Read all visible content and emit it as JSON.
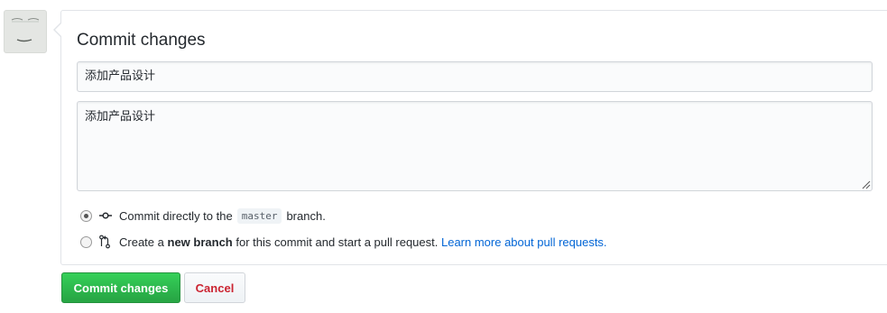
{
  "avatar": {
    "icon": "user-avatar"
  },
  "commit_form": {
    "title": "Commit changes",
    "summary_value": "添加产品设计",
    "description_value": "添加产品设计",
    "options": {
      "direct": {
        "selected": true,
        "text_before": "Commit directly to the",
        "branch": "master",
        "text_after": "branch."
      },
      "new_branch": {
        "selected": false,
        "text_before": "Create a",
        "bold": "new branch",
        "text_after": "for this commit and start a pull request.",
        "link": "Learn more about pull requests."
      }
    }
  },
  "actions": {
    "commit_label": "Commit changes",
    "cancel_label": "Cancel"
  },
  "colors": {
    "primary_button": "#28a745",
    "cancel_text": "#cb2431",
    "link": "#0366d6"
  }
}
